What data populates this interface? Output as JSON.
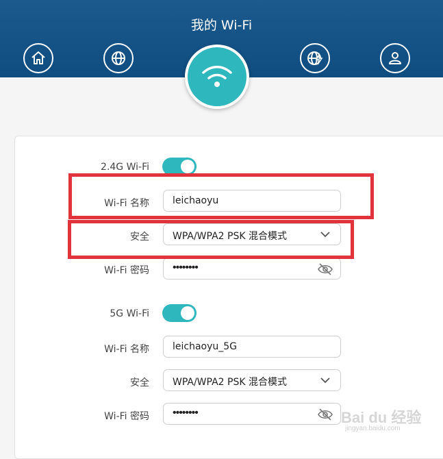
{
  "header": {
    "title": "我的 Wi-Fi",
    "nav": [
      "home-icon",
      "globe-icon",
      "wifi-icon",
      "globe-lightning-icon",
      "user-icon"
    ]
  },
  "colors": {
    "header": "#1a5a8e",
    "accent": "#2fb7be",
    "highlight": "#e0333b"
  },
  "wifi24": {
    "toggle_label": "2.4G Wi-Fi",
    "toggle_on": true,
    "name_label": "Wi-Fi 名称",
    "name_value": "leichaoyu",
    "security_label": "安全",
    "security_value": "WPA/WPA2 PSK 混合模式",
    "password_label": "Wi-Fi 密码",
    "password_value": "••••••••"
  },
  "wifi5": {
    "toggle_label": "5G Wi-Fi",
    "toggle_on": true,
    "name_label": "Wi-Fi 名称",
    "name_value": "leichaoyu_5G",
    "security_label": "安全",
    "security_value": "WPA/WPA2 PSK 混合模式",
    "password_label": "Wi-Fi 密码",
    "password_value": "••••••••"
  },
  "watermark": {
    "brand": "Bai du 经验",
    "url": "jingyan.baidu.com"
  }
}
